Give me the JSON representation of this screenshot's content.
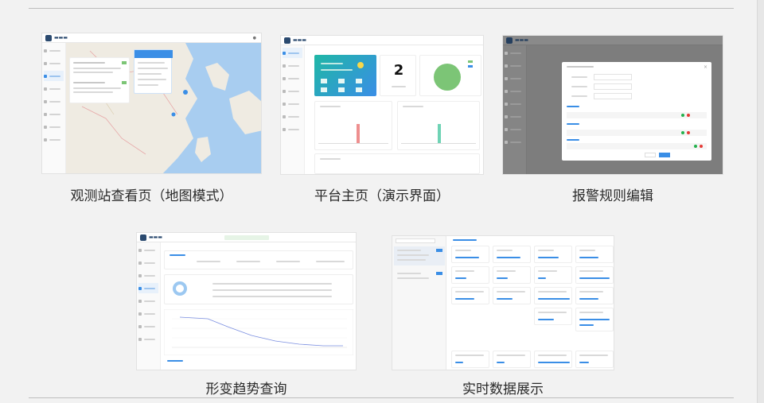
{
  "captions": {
    "map_view": "观测站查看页（地图模式）",
    "home": "平台主页（演示界面）",
    "alarm_rules": "报警规则编辑",
    "deformation": "形变趋势查询",
    "realtime": "实时数据展示"
  },
  "home_demo": {
    "big_number": "2"
  },
  "colors": {
    "teal": "#1fb7a6",
    "green": "#7cc576",
    "blue": "#3a8ee6",
    "map_water": "#a8cdf0",
    "map_land": "#efebe2",
    "coral": "#ee8f8f"
  }
}
